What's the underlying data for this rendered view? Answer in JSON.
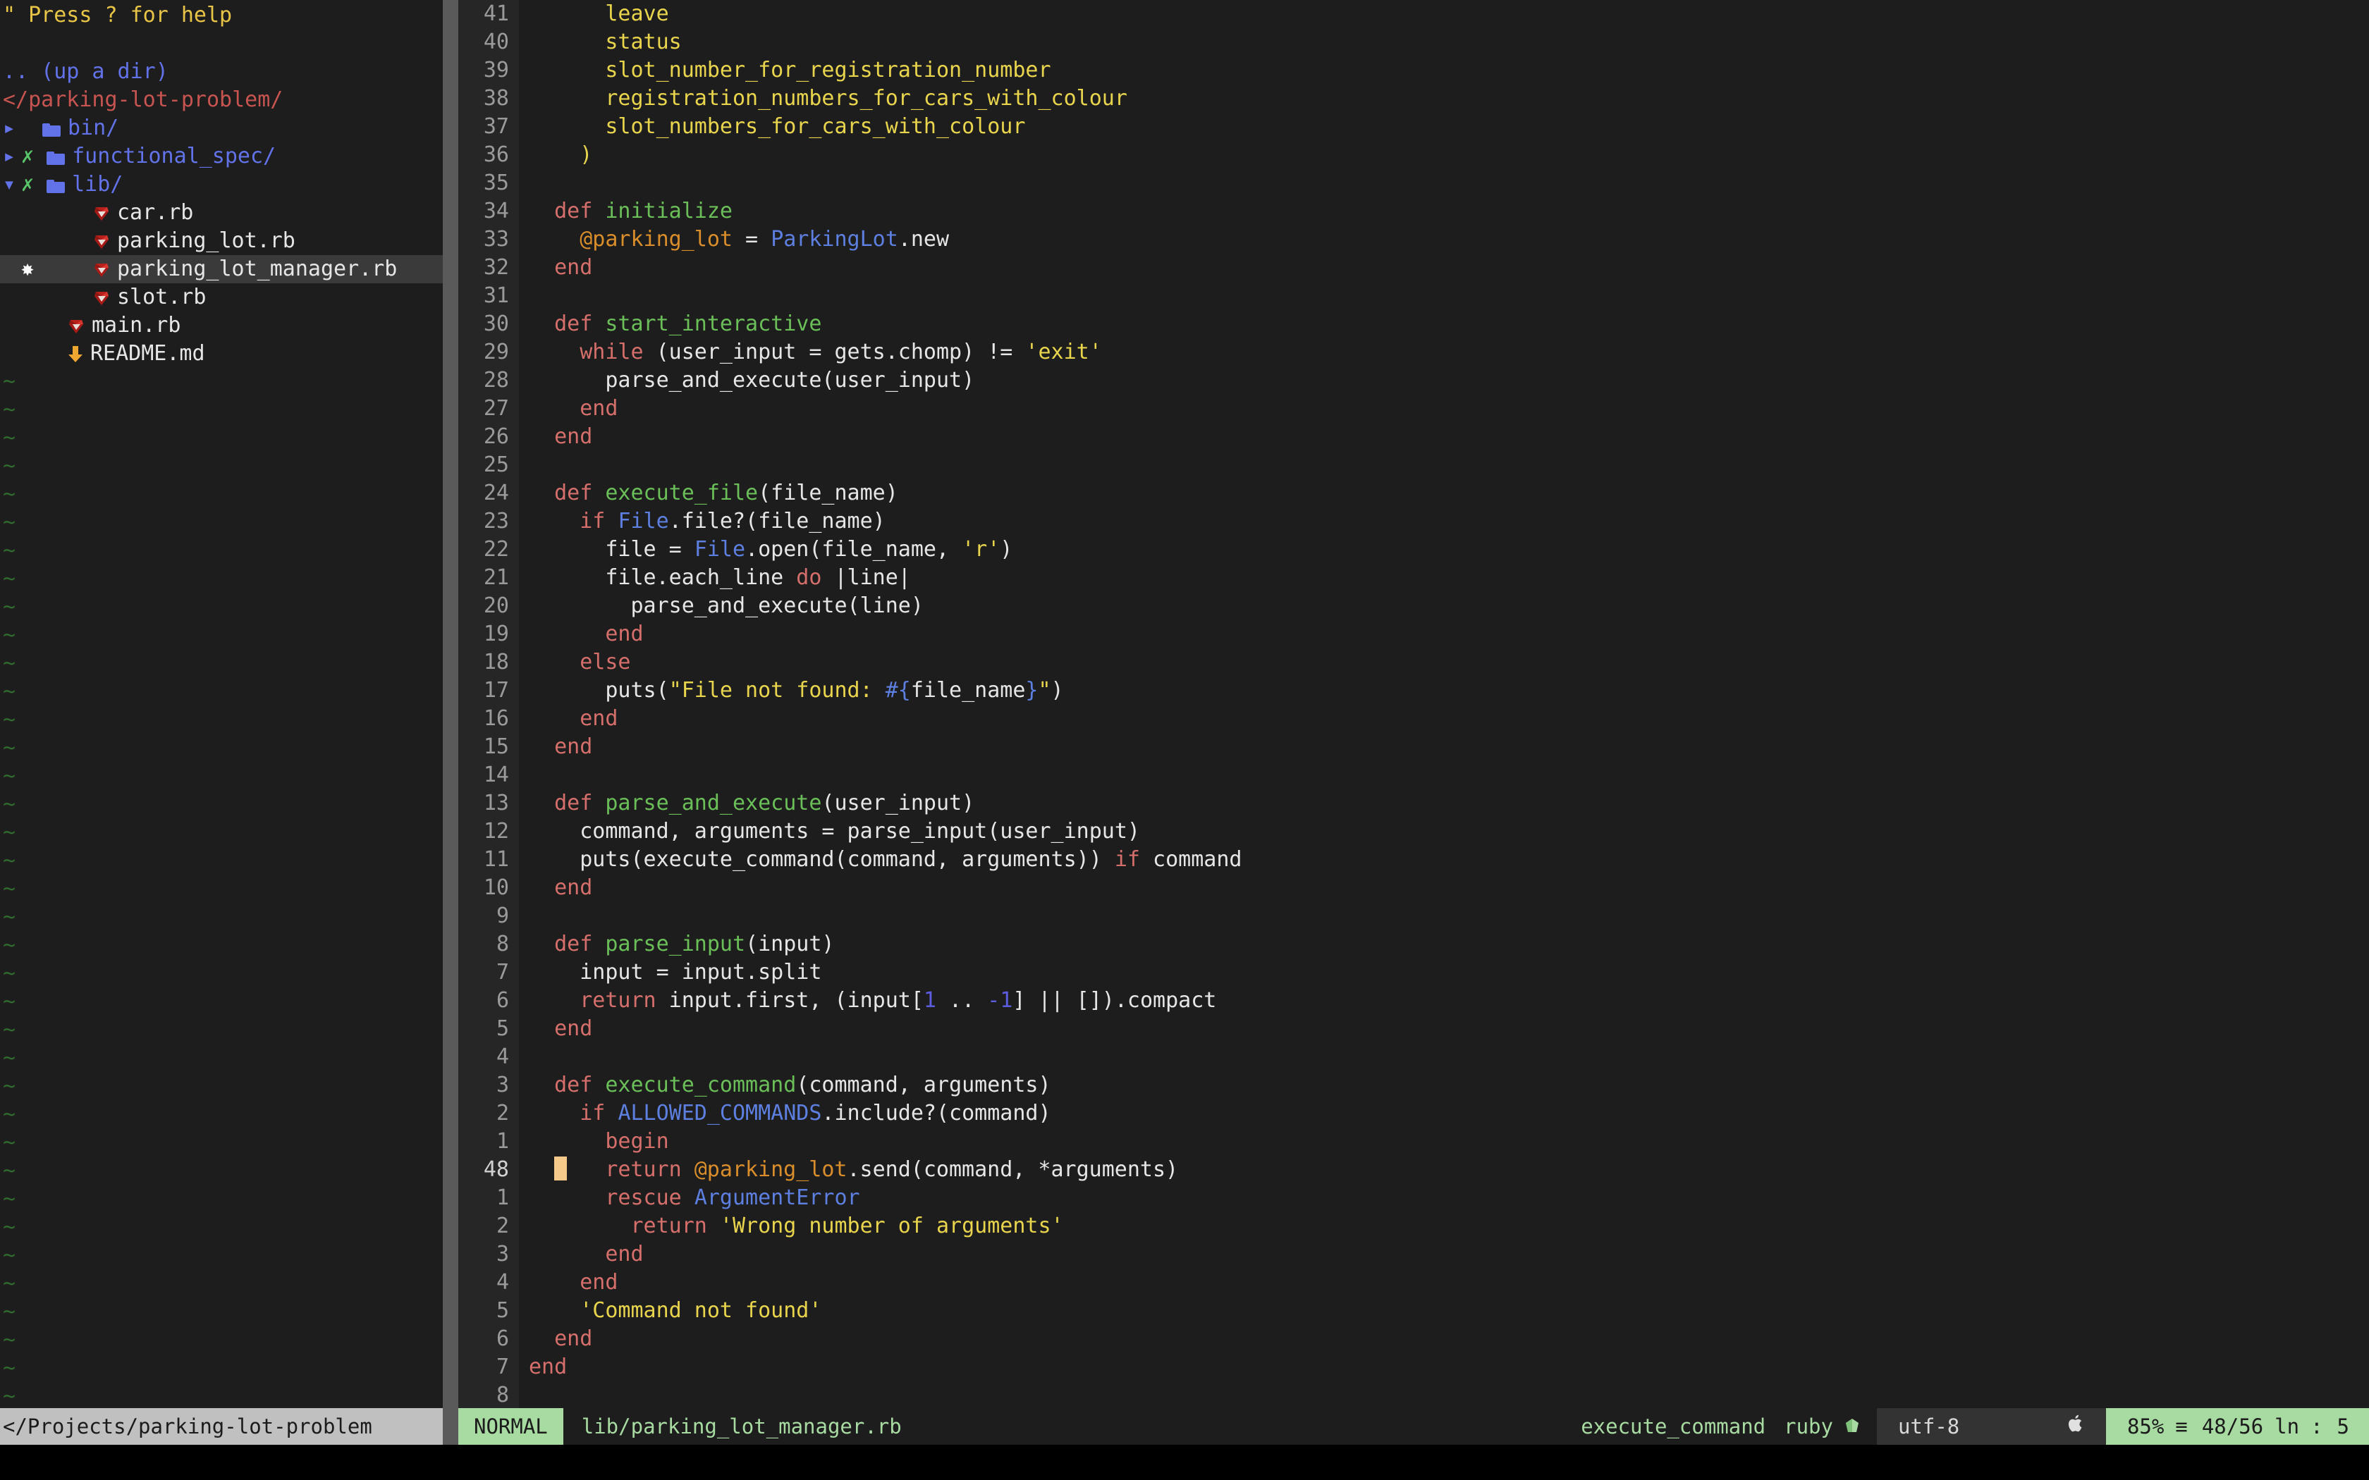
{
  "app": {
    "kind": "neovim-editor",
    "background": "#1d1d1d",
    "accent_green": "#a8dba2",
    "cursor_color": "#f5c98a"
  },
  "sidebar": {
    "help_hint": "\" Press ? for help",
    "up_a_dir": ".. (up a dir)",
    "root": "</parking-lot-problem/",
    "items": [
      {
        "chevron": "▸",
        "git": "",
        "icon": "folder-icon",
        "label": "bin/",
        "type": "dir",
        "indent": 1,
        "selected": false
      },
      {
        "chevron": "▸",
        "git": "✗",
        "icon": "folder-icon",
        "label": "functional_spec/",
        "type": "dir",
        "indent": 1,
        "selected": false
      },
      {
        "chevron": "▾",
        "git": "✗",
        "icon": "folder-icon",
        "label": "lib/",
        "type": "dir",
        "indent": 1,
        "selected": false
      },
      {
        "chevron": "",
        "git": "",
        "icon": "ruby-file-icon",
        "label": "car.rb",
        "type": "file",
        "indent": 3,
        "selected": false
      },
      {
        "chevron": "",
        "git": "",
        "icon": "ruby-file-icon",
        "label": "parking_lot.rb",
        "type": "file",
        "indent": 3,
        "selected": false
      },
      {
        "chevron": "",
        "git": "✸",
        "icon": "ruby-file-icon",
        "label": "parking_lot_manager.rb",
        "type": "file",
        "indent": 3,
        "selected": true
      },
      {
        "chevron": "",
        "git": "",
        "icon": "ruby-file-icon",
        "label": "slot.rb",
        "type": "file",
        "indent": 3,
        "selected": false
      },
      {
        "chevron": "",
        "git": "",
        "icon": "ruby-file-icon",
        "label": "main.rb",
        "type": "file",
        "indent": 2,
        "selected": false
      },
      {
        "chevron": "",
        "git": "",
        "icon": "markdown-file-icon",
        "label": "README.md",
        "type": "file",
        "indent": 2,
        "selected": false
      }
    ],
    "tilde": "~",
    "tilde_count": 37
  },
  "editor": {
    "lines": [
      {
        "num": "41",
        "cursor": false,
        "tokens": [
          {
            "t": "      ",
            "c": "pln"
          },
          {
            "t": "leave",
            "c": "str"
          }
        ]
      },
      {
        "num": "40",
        "cursor": false,
        "tokens": [
          {
            "t": "      ",
            "c": "pln"
          },
          {
            "t": "status",
            "c": "str"
          }
        ]
      },
      {
        "num": "39",
        "cursor": false,
        "tokens": [
          {
            "t": "      ",
            "c": "pln"
          },
          {
            "t": "slot_number_for_registration_number",
            "c": "str"
          }
        ]
      },
      {
        "num": "38",
        "cursor": false,
        "tokens": [
          {
            "t": "      ",
            "c": "pln"
          },
          {
            "t": "registration_numbers_for_cars_with_colour",
            "c": "str"
          }
        ]
      },
      {
        "num": "37",
        "cursor": false,
        "tokens": [
          {
            "t": "      ",
            "c": "pln"
          },
          {
            "t": "slot_numbers_for_cars_with_colour",
            "c": "str"
          }
        ]
      },
      {
        "num": "36",
        "cursor": false,
        "tokens": [
          {
            "t": "    ",
            "c": "pln"
          },
          {
            "t": ")",
            "c": "str"
          }
        ]
      },
      {
        "num": "35",
        "cursor": false,
        "tokens": []
      },
      {
        "num": "34",
        "cursor": false,
        "tokens": [
          {
            "t": "  ",
            "c": "pln"
          },
          {
            "t": "def",
            "c": "kw"
          },
          {
            "t": " ",
            "c": "pln"
          },
          {
            "t": "initialize",
            "c": "fn"
          }
        ]
      },
      {
        "num": "33",
        "cursor": false,
        "tokens": [
          {
            "t": "    ",
            "c": "pln"
          },
          {
            "t": "@parking_lot",
            "c": "ivar"
          },
          {
            "t": " = ",
            "c": "pln"
          },
          {
            "t": "ParkingLot",
            "c": "cst"
          },
          {
            "t": ".new",
            "c": "pln"
          }
        ]
      },
      {
        "num": "32",
        "cursor": false,
        "tokens": [
          {
            "t": "  ",
            "c": "pln"
          },
          {
            "t": "end",
            "c": "kw"
          }
        ]
      },
      {
        "num": "31",
        "cursor": false,
        "tokens": []
      },
      {
        "num": "30",
        "cursor": false,
        "tokens": [
          {
            "t": "  ",
            "c": "pln"
          },
          {
            "t": "def",
            "c": "kw"
          },
          {
            "t": " ",
            "c": "pln"
          },
          {
            "t": "start_interactive",
            "c": "fn"
          }
        ]
      },
      {
        "num": "29",
        "cursor": false,
        "tokens": [
          {
            "t": "    ",
            "c": "pln"
          },
          {
            "t": "while",
            "c": "kw"
          },
          {
            "t": " (user_input = gets.chomp) != ",
            "c": "pln"
          },
          {
            "t": "'exit'",
            "c": "str"
          }
        ]
      },
      {
        "num": "28",
        "cursor": false,
        "tokens": [
          {
            "t": "      parse_and_execute(user_input)",
            "c": "pln"
          }
        ]
      },
      {
        "num": "27",
        "cursor": false,
        "tokens": [
          {
            "t": "    ",
            "c": "pln"
          },
          {
            "t": "end",
            "c": "kw"
          }
        ]
      },
      {
        "num": "26",
        "cursor": false,
        "tokens": [
          {
            "t": "  ",
            "c": "pln"
          },
          {
            "t": "end",
            "c": "kw"
          }
        ]
      },
      {
        "num": "25",
        "cursor": false,
        "tokens": []
      },
      {
        "num": "24",
        "cursor": false,
        "tokens": [
          {
            "t": "  ",
            "c": "pln"
          },
          {
            "t": "def",
            "c": "kw"
          },
          {
            "t": " ",
            "c": "pln"
          },
          {
            "t": "execute_file",
            "c": "fn"
          },
          {
            "t": "(file_name)",
            "c": "pln"
          }
        ]
      },
      {
        "num": "23",
        "cursor": false,
        "tokens": [
          {
            "t": "    ",
            "c": "pln"
          },
          {
            "t": "if",
            "c": "kw"
          },
          {
            "t": " ",
            "c": "pln"
          },
          {
            "t": "File",
            "c": "cst"
          },
          {
            "t": ".file?(file_name)",
            "c": "pln"
          }
        ]
      },
      {
        "num": "22",
        "cursor": false,
        "tokens": [
          {
            "t": "      file = ",
            "c": "pln"
          },
          {
            "t": "File",
            "c": "cst"
          },
          {
            "t": ".open(file_name, ",
            "c": "pln"
          },
          {
            "t": "'r'",
            "c": "str"
          },
          {
            "t": ")",
            "c": "pln"
          }
        ]
      },
      {
        "num": "21",
        "cursor": false,
        "tokens": [
          {
            "t": "      file.each_line ",
            "c": "pln"
          },
          {
            "t": "do",
            "c": "kw"
          },
          {
            "t": " |line|",
            "c": "pln"
          }
        ]
      },
      {
        "num": "20",
        "cursor": false,
        "tokens": [
          {
            "t": "        parse_and_execute(line)",
            "c": "pln"
          }
        ]
      },
      {
        "num": "19",
        "cursor": false,
        "tokens": [
          {
            "t": "      ",
            "c": "pln"
          },
          {
            "t": "end",
            "c": "kw"
          }
        ]
      },
      {
        "num": "18",
        "cursor": false,
        "tokens": [
          {
            "t": "    ",
            "c": "pln"
          },
          {
            "t": "else",
            "c": "kw"
          }
        ]
      },
      {
        "num": "17",
        "cursor": false,
        "tokens": [
          {
            "t": "      puts(",
            "c": "pln"
          },
          {
            "t": "\"File not found: ",
            "c": "str"
          },
          {
            "t": "#{",
            "c": "dlm"
          },
          {
            "t": "file_name",
            "c": "pln"
          },
          {
            "t": "}",
            "c": "dlm"
          },
          {
            "t": "\"",
            "c": "str"
          },
          {
            "t": ")",
            "c": "pln"
          }
        ]
      },
      {
        "num": "16",
        "cursor": false,
        "tokens": [
          {
            "t": "    ",
            "c": "pln"
          },
          {
            "t": "end",
            "c": "kw"
          }
        ]
      },
      {
        "num": "15",
        "cursor": false,
        "tokens": [
          {
            "t": "  ",
            "c": "pln"
          },
          {
            "t": "end",
            "c": "kw"
          }
        ]
      },
      {
        "num": "14",
        "cursor": false,
        "tokens": []
      },
      {
        "num": "13",
        "cursor": false,
        "tokens": [
          {
            "t": "  ",
            "c": "pln"
          },
          {
            "t": "def",
            "c": "kw"
          },
          {
            "t": " ",
            "c": "pln"
          },
          {
            "t": "parse_and_execute",
            "c": "fn"
          },
          {
            "t": "(user_input)",
            "c": "pln"
          }
        ]
      },
      {
        "num": "12",
        "cursor": false,
        "tokens": [
          {
            "t": "    command, arguments = parse_input(user_input)",
            "c": "pln"
          }
        ]
      },
      {
        "num": "11",
        "cursor": false,
        "tokens": [
          {
            "t": "    puts(execute_command(command, arguments)) ",
            "c": "pln"
          },
          {
            "t": "if",
            "c": "kw"
          },
          {
            "t": " command",
            "c": "pln"
          }
        ]
      },
      {
        "num": "10",
        "cursor": false,
        "tokens": [
          {
            "t": "  ",
            "c": "pln"
          },
          {
            "t": "end",
            "c": "kw"
          }
        ]
      },
      {
        "num": "9",
        "cursor": false,
        "tokens": []
      },
      {
        "num": "8",
        "cursor": false,
        "tokens": [
          {
            "t": "  ",
            "c": "pln"
          },
          {
            "t": "def",
            "c": "kw"
          },
          {
            "t": " ",
            "c": "pln"
          },
          {
            "t": "parse_input",
            "c": "fn"
          },
          {
            "t": "(input)",
            "c": "pln"
          }
        ]
      },
      {
        "num": "7",
        "cursor": false,
        "tokens": [
          {
            "t": "    input = input.split",
            "c": "pln"
          }
        ]
      },
      {
        "num": "6",
        "cursor": false,
        "tokens": [
          {
            "t": "    ",
            "c": "pln"
          },
          {
            "t": "return",
            "c": "kw"
          },
          {
            "t": " input.first, (input[",
            "c": "pln"
          },
          {
            "t": "1",
            "c": "num"
          },
          {
            "t": " .. ",
            "c": "pln"
          },
          {
            "t": "-1",
            "c": "num"
          },
          {
            "t": "] || []).compact",
            "c": "pln"
          }
        ]
      },
      {
        "num": "5",
        "cursor": false,
        "tokens": [
          {
            "t": "  ",
            "c": "pln"
          },
          {
            "t": "end",
            "c": "kw"
          }
        ]
      },
      {
        "num": "4",
        "cursor": false,
        "tokens": []
      },
      {
        "num": "3",
        "cursor": false,
        "tokens": [
          {
            "t": "  ",
            "c": "pln"
          },
          {
            "t": "def",
            "c": "kw"
          },
          {
            "t": " ",
            "c": "pln"
          },
          {
            "t": "execute_command",
            "c": "fn"
          },
          {
            "t": "(command, arguments)",
            "c": "pln"
          }
        ]
      },
      {
        "num": "2",
        "cursor": false,
        "tokens": [
          {
            "t": "    ",
            "c": "pln"
          },
          {
            "t": "if",
            "c": "kw"
          },
          {
            "t": " ",
            "c": "pln"
          },
          {
            "t": "ALLOWED_COMMANDS",
            "c": "cst"
          },
          {
            "t": ".include?(command)",
            "c": "pln"
          }
        ]
      },
      {
        "num": "1",
        "cursor": false,
        "tokens": [
          {
            "t": "      ",
            "c": "pln"
          },
          {
            "t": "begin",
            "c": "kw"
          }
        ]
      },
      {
        "num": "48",
        "cursor": true,
        "tokens": [
          {
            "t": "  ",
            "c": "pln"
          },
          {
            "t": "__CURSOR__",
            "c": "pln"
          },
          {
            "t": "   ",
            "c": "pln"
          },
          {
            "t": "return",
            "c": "kw"
          },
          {
            "t": " ",
            "c": "pln"
          },
          {
            "t": "@parking_lot",
            "c": "ivar"
          },
          {
            "t": ".send(command, *arguments)",
            "c": "pln"
          }
        ]
      },
      {
        "num": "1",
        "cursor": false,
        "tokens": [
          {
            "t": "      ",
            "c": "pln"
          },
          {
            "t": "rescue",
            "c": "kw"
          },
          {
            "t": " ",
            "c": "pln"
          },
          {
            "t": "ArgumentError",
            "c": "cst"
          }
        ]
      },
      {
        "num": "2",
        "cursor": false,
        "tokens": [
          {
            "t": "        ",
            "c": "pln"
          },
          {
            "t": "return",
            "c": "kw"
          },
          {
            "t": " ",
            "c": "pln"
          },
          {
            "t": "'Wrong number of arguments'",
            "c": "str"
          }
        ]
      },
      {
        "num": "3",
        "cursor": false,
        "tokens": [
          {
            "t": "      ",
            "c": "pln"
          },
          {
            "t": "end",
            "c": "kw"
          }
        ]
      },
      {
        "num": "4",
        "cursor": false,
        "tokens": [
          {
            "t": "    ",
            "c": "pln"
          },
          {
            "t": "end",
            "c": "kw"
          }
        ]
      },
      {
        "num": "5",
        "cursor": false,
        "tokens": [
          {
            "t": "    ",
            "c": "pln"
          },
          {
            "t": "'Command not found'",
            "c": "str"
          }
        ]
      },
      {
        "num": "6",
        "cursor": false,
        "tokens": [
          {
            "t": "  ",
            "c": "pln"
          },
          {
            "t": "end",
            "c": "kw"
          }
        ]
      },
      {
        "num": "7",
        "cursor": false,
        "tokens": [
          {
            "t": "",
            "c": "pln"
          },
          {
            "t": "end",
            "c": "kw"
          }
        ]
      },
      {
        "num": "8",
        "cursor": false,
        "tokens": []
      }
    ]
  },
  "statusline": {
    "path": "</Projects/parking-lot-problem",
    "mode": "NORMAL",
    "file": "lib/parking_lot_manager.rb",
    "function": "execute_command",
    "filetype": "ruby",
    "filetype_icon": "ruby-icon",
    "encoding": "utf-8",
    "os_icon": "apple-icon",
    "percent": "85%",
    "lines_icon": "≡",
    "position": "48/56",
    "ln_label": "ln",
    "column": "5",
    "colon": ":"
  }
}
